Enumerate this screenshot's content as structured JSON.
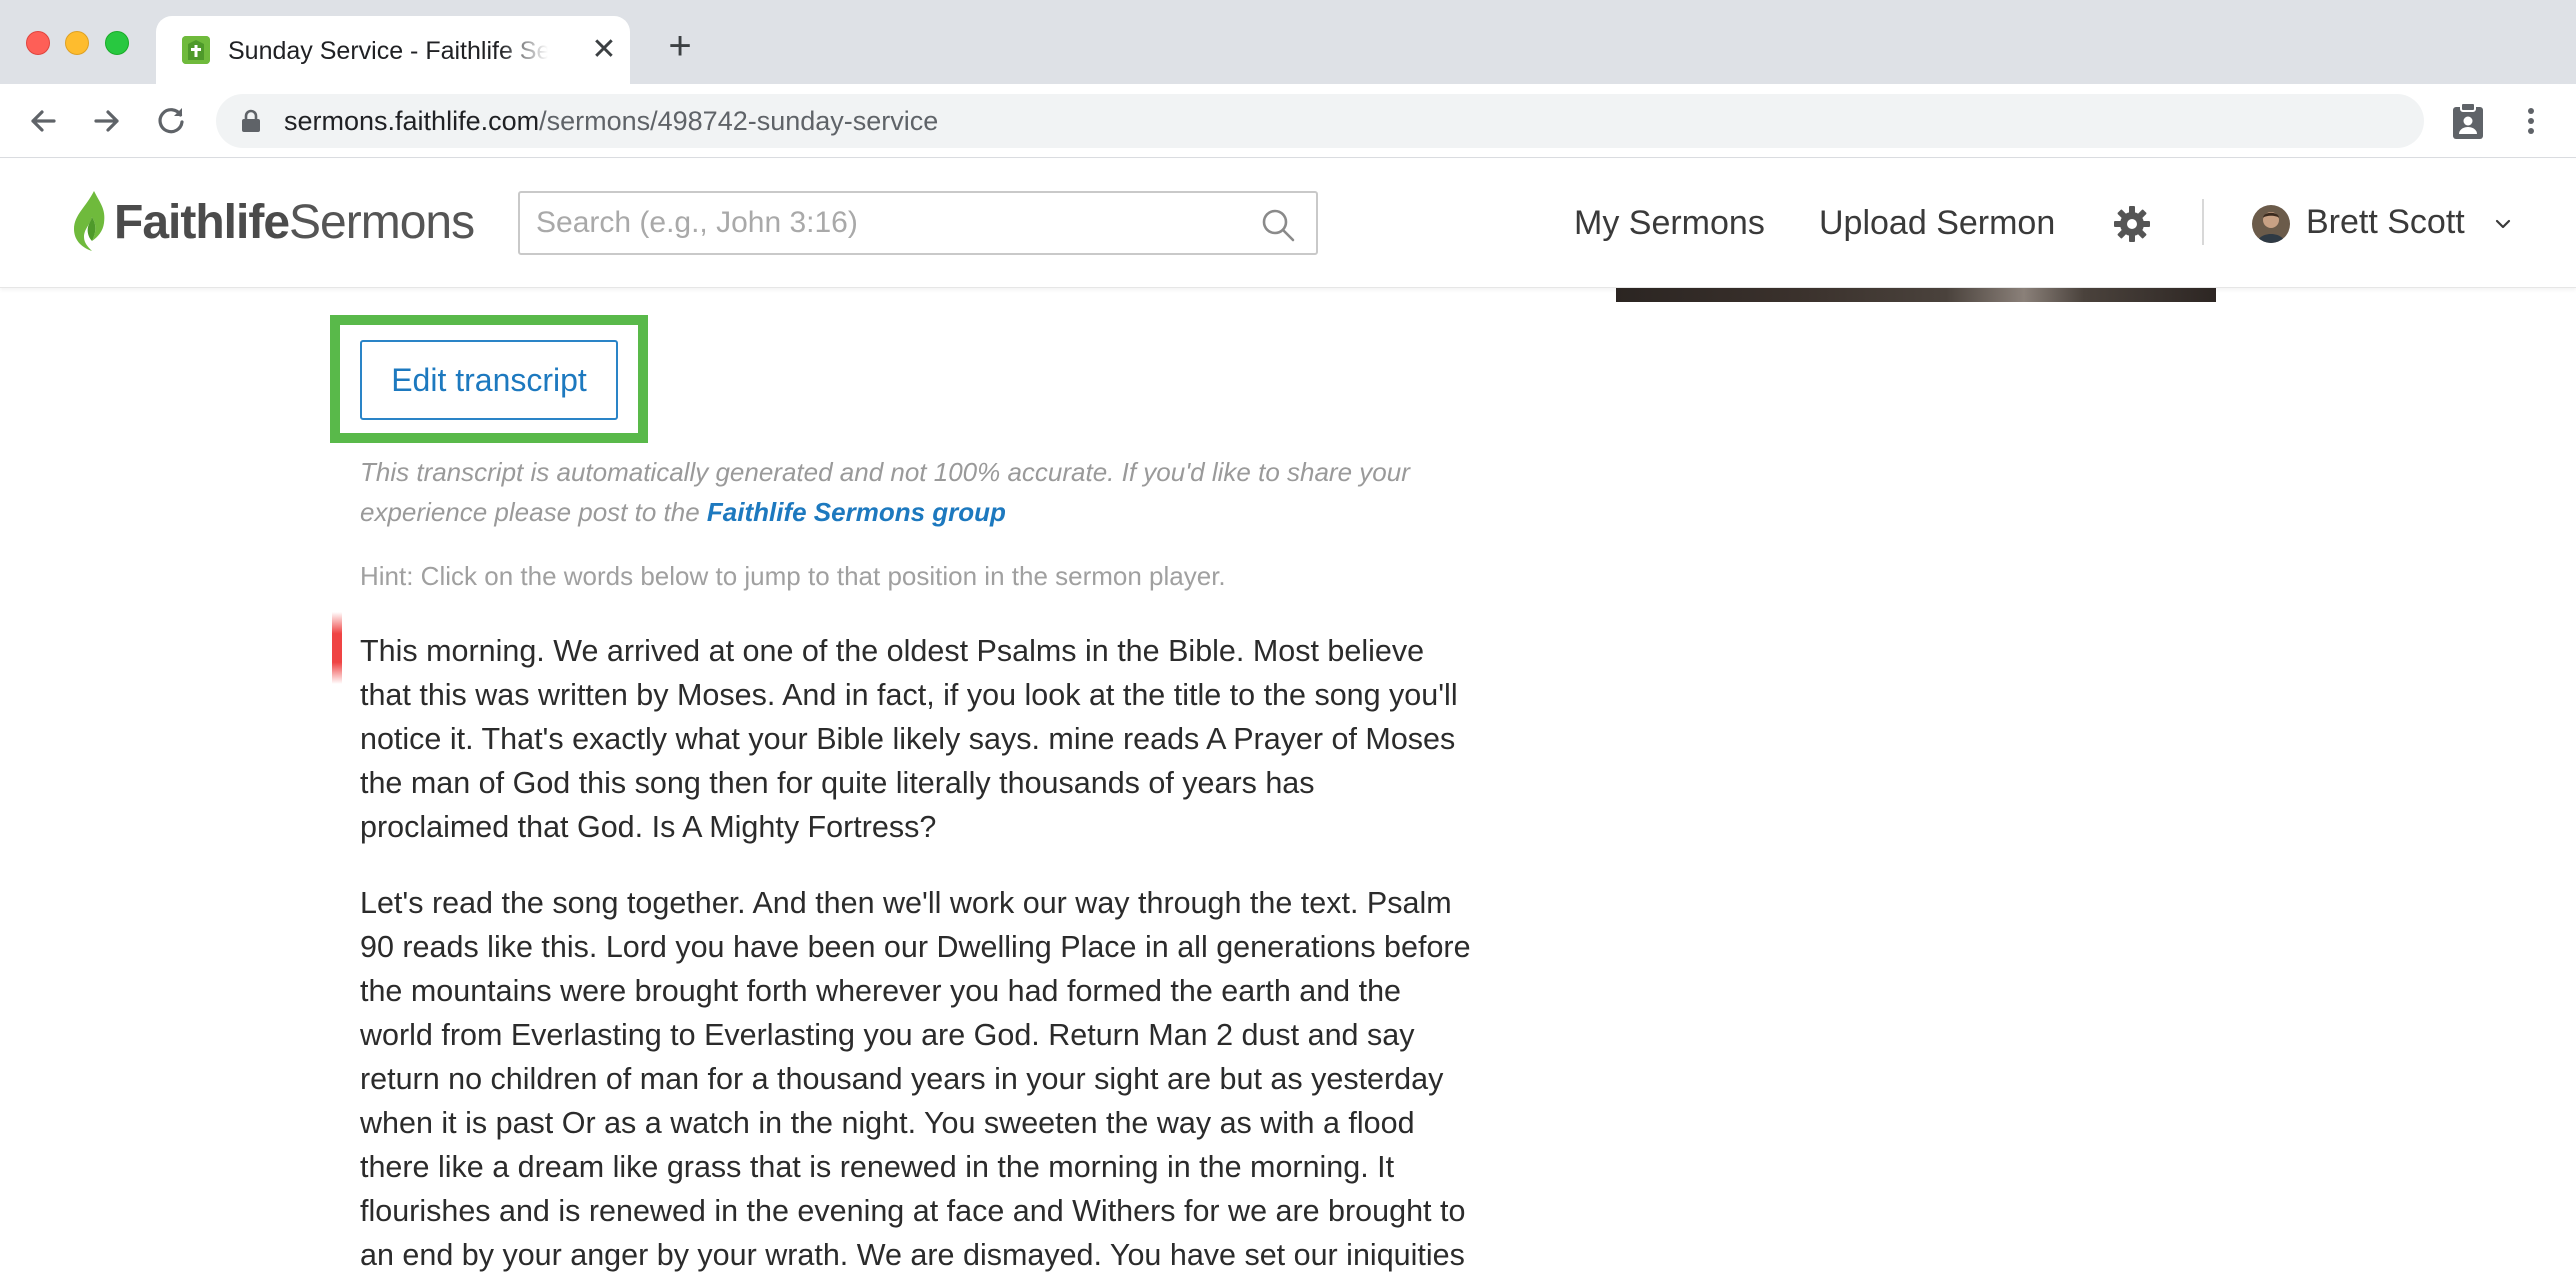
{
  "browser": {
    "tab_title": "Sunday Service - Faithlife Sermons",
    "tab_close": "✕",
    "new_tab": "+",
    "url_host": "sermons.faithlife.com",
    "url_path": "/sermons/498742-sunday-service"
  },
  "header": {
    "logo_faithlife": "Faithlife",
    "logo_sermons": "Sermons",
    "search_placeholder": "Search (e.g., John 3:16)",
    "nav": {
      "my_sermons": "My Sermons",
      "upload_sermon": "Upload Sermon"
    },
    "user_name": "Brett Scott"
  },
  "transcript": {
    "edit_button": "Edit transcript",
    "disclaimer_line1": "This transcript is automatically generated and not 100% accurate. If you'd like to share your",
    "disclaimer_line2_prefix": "experience please post to the ",
    "disclaimer_link": "Faithlife Sermons group",
    "hint": "Hint: Click on the words below to jump to that position in the sermon player.",
    "paragraph1_lines": [
      "This morning. We arrived at one of the oldest Psalms in the Bible. Most believe",
      "that this was written by Moses. And in fact, if you look at the title to the song you'll",
      "notice it. That's exactly what your Bible likely says. mine reads A Prayer of Moses",
      "the man of God this song then for quite literally thousands of years has",
      "proclaimed that God. Is A Mighty Fortress?"
    ],
    "paragraph2_lines": [
      "Let's read the song together. And then we'll work our way through the text. Psalm",
      "90 reads like this. Lord you have been our Dwelling Place in all generations before",
      "the mountains were brought forth wherever you had formed the earth and the",
      "world from Everlasting to Everlasting you are God. Return Man 2 dust and say",
      "return no children of man for a thousand years in your sight are but as yesterday",
      "when it is past Or as a watch in the night. You sweeten the way as with a flood",
      "there like a dream like grass that is renewed in the morning in the morning. It",
      "flourishes and is renewed in the evening at face and Withers for we are brought to",
      "an end by your anger by your wrath. We are dismayed. You have set our iniquities"
    ]
  },
  "colors": {
    "brand_green": "#6fba3c",
    "link_blue": "#1d79bf",
    "highlight_green": "#59b94a",
    "playhead_red": "#ef4444"
  },
  "icons": [
    "back-arrow-icon",
    "forward-arrow-icon",
    "reload-icon",
    "lock-icon",
    "clipboard-extension-icon",
    "kebab-menu-icon",
    "search-icon",
    "gear-icon",
    "chevron-down-icon",
    "faithlife-flame-icon",
    "tab-favicon-icon"
  ]
}
